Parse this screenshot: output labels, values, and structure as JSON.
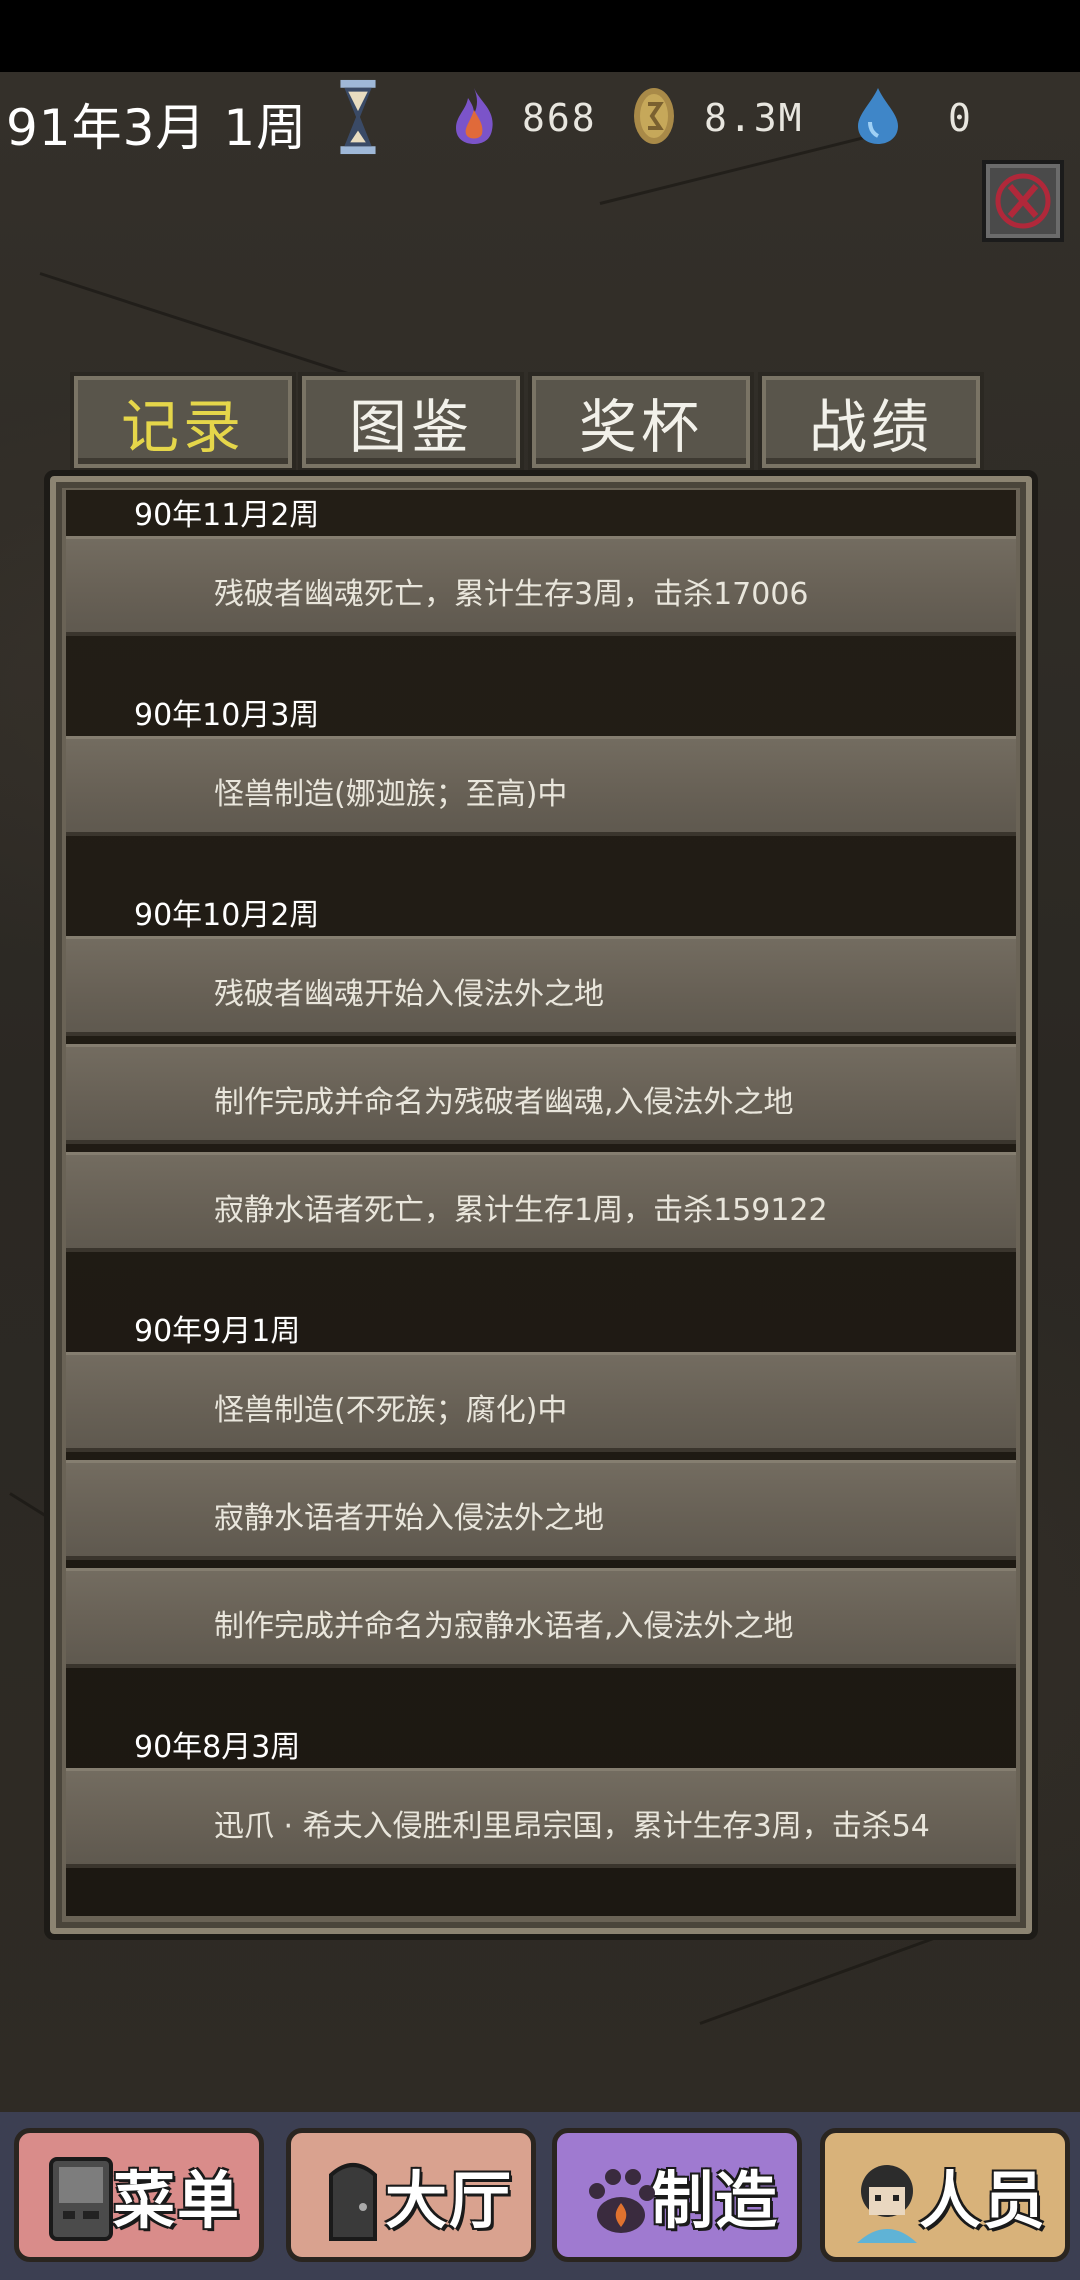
{
  "hud": {
    "date": "91年3月 1周",
    "resources": [
      {
        "icon": "purple-flame-icon",
        "value": "868"
      },
      {
        "icon": "gold-coin-icon",
        "value": "8.3M"
      },
      {
        "icon": "blue-drop-icon",
        "value": "0"
      }
    ]
  },
  "tabs": [
    {
      "label": "记录",
      "active": true
    },
    {
      "label": "图鉴",
      "active": false
    },
    {
      "label": "奖杯",
      "active": false
    },
    {
      "label": "战绩",
      "active": false
    }
  ],
  "records": [
    {
      "date": "90年11月2周",
      "entries": [
        "残破者幽魂死亡，累计生存3周，击杀17006"
      ]
    },
    {
      "date": "90年10月3周",
      "entries": [
        "怪兽制造(娜迦族；至高)中"
      ]
    },
    {
      "date": "90年10月2周",
      "entries": [
        "残破者幽魂开始入侵法外之地",
        "制作完成并命名为残破者幽魂,入侵法外之地",
        "寂静水语者死亡，累计生存1周，击杀159122"
      ]
    },
    {
      "date": "90年9月1周",
      "entries": [
        "怪兽制造(不死族；腐化)中",
        "寂静水语者开始入侵法外之地",
        "制作完成并命名为寂静水语者,入侵法外之地"
      ]
    },
    {
      "date": "90年8月3周",
      "entries": [
        "迅爪 · 希夫入侵胜利里昂宗国，累计生存3周，击杀54"
      ]
    }
  ],
  "nav": [
    {
      "label": "菜单",
      "icon": "menu-device-icon"
    },
    {
      "label": "大厅",
      "icon": "hall-door-icon"
    },
    {
      "label": "制造",
      "icon": "craft-paw-icon"
    },
    {
      "label": "人员",
      "icon": "person-avatar-icon"
    }
  ],
  "colors": {
    "active_tab": "#e5d64a",
    "panel_bg": "#1f1b14",
    "entry_bg": "#6d675c"
  }
}
